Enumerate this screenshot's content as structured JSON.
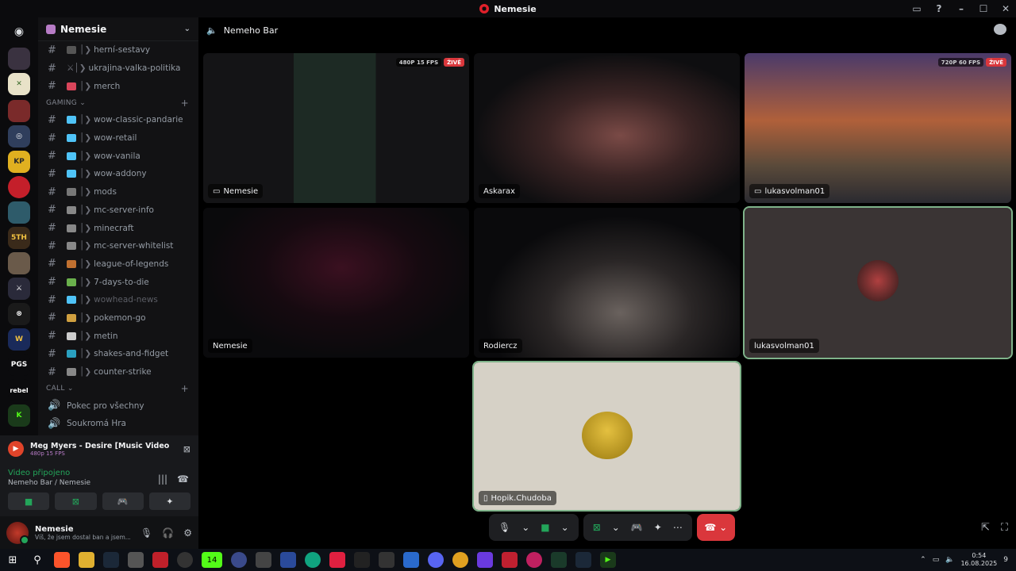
{
  "window": {
    "title": "Nemesie"
  },
  "guild": {
    "name": "Nemesie"
  },
  "channels_top": [
    "herní-sestavy",
    "ukrajina-valka-politika",
    "merch"
  ],
  "gaming_category": "GAMING",
  "gaming_channels": [
    {
      "name": "wow-classic-pandarie",
      "muted": false
    },
    {
      "name": "wow-retail",
      "muted": false
    },
    {
      "name": "wow-vanila",
      "muted": false
    },
    {
      "name": "wow-addony",
      "muted": false
    },
    {
      "name": "mods",
      "muted": false
    },
    {
      "name": "mc-server-info",
      "muted": false
    },
    {
      "name": "minecraft",
      "muted": false
    },
    {
      "name": "mc-server-whitelist",
      "muted": false
    },
    {
      "name": "league-of-legends",
      "muted": false
    },
    {
      "name": "7-days-to-die",
      "muted": false
    },
    {
      "name": "wowhead-news",
      "muted": true
    },
    {
      "name": "pokemon-go",
      "muted": false
    },
    {
      "name": "metin",
      "muted": false
    },
    {
      "name": "shakes-and-fidget",
      "muted": false
    },
    {
      "name": "counter-strike",
      "muted": false
    }
  ],
  "call_category": "CALL",
  "call_channels": [
    "Pokec pro všechny",
    "Soukromá Hra"
  ],
  "activity": {
    "title": "Meg Myers - Desire [Music Video] - YouTu...",
    "quality": "480p 15 FPS"
  },
  "voice": {
    "status": "Video připojeno",
    "location": "Nemeho Bar / Nemesie"
  },
  "user": {
    "name": "Nemesie",
    "status": "Víš, že jsem dostal ban a jsem..."
  },
  "stage": {
    "channel": "Nemeho Bar"
  },
  "tiles": {
    "t1": {
      "name": "Nemesie",
      "fps": "480P 15 FPS",
      "live": "ŽIVĚ"
    },
    "t2": {
      "name": "Askarax"
    },
    "t3": {
      "name": "lukasvolman01",
      "fps": "720P 60 FPS",
      "live": "ŽIVĚ"
    },
    "t4": {
      "name": "Nemesie"
    },
    "t5": {
      "name": "Rodiercz"
    },
    "t6": {
      "name": "lukasvolman01"
    },
    "t7": {
      "name": "Hopik.Chudoba"
    }
  },
  "taskbar": {
    "time": "0:54",
    "date": "16.08.2025",
    "badge": "14",
    "notif": "9"
  },
  "colors": {
    "accent_green": "#23a55a",
    "danger": "#da373c",
    "speaking": "#7fb38a"
  }
}
